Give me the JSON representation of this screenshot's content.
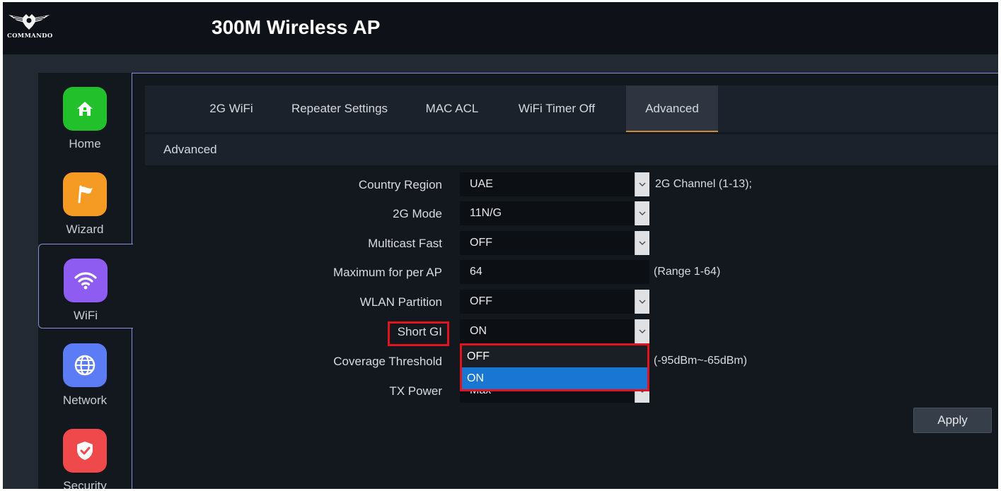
{
  "app": {
    "logo_text": "COMMANDO",
    "title": "300M Wireless AP"
  },
  "sidebar": {
    "items": [
      {
        "label": "Home",
        "icon": "home-icon",
        "color": "#22c02a"
      },
      {
        "label": "Wizard",
        "icon": "flag-icon",
        "color": "#f59a23"
      },
      {
        "label": "WiFi",
        "icon": "wifi-icon",
        "color": "#8e5cf0",
        "active": true
      },
      {
        "label": "Network",
        "icon": "globe-icon",
        "color": "#5b7cf5"
      },
      {
        "label": "Security",
        "icon": "shield-icon",
        "color": "#f0494c"
      }
    ]
  },
  "tabs": [
    {
      "label": "2G WiFi"
    },
    {
      "label": "Repeater Settings"
    },
    {
      "label": "MAC ACL"
    },
    {
      "label": "WiFi Timer Off"
    },
    {
      "label": "Advanced",
      "active": true
    }
  ],
  "section": {
    "title": "Advanced"
  },
  "form": {
    "country_region": {
      "label": "Country Region",
      "value": "UAE",
      "hint": "2G Channel (1-13);"
    },
    "mode_2g": {
      "label": "2G Mode",
      "value": "11N/G"
    },
    "multicast_fast": {
      "label": "Multicast Fast",
      "value": "OFF"
    },
    "max_per_ap": {
      "label": "Maximum for per AP",
      "value": "64",
      "hint": "(Range 1-64)"
    },
    "wlan_partition": {
      "label": "WLAN Partition",
      "value": "OFF"
    },
    "short_gi": {
      "label": "Short GI",
      "value": "ON",
      "options": [
        "OFF",
        "ON"
      ],
      "highlighted_option": "ON"
    },
    "coverage_threshold": {
      "label": "Coverage Threshold",
      "hint": "(-95dBm~-65dBm)"
    },
    "tx_power": {
      "label": "TX Power",
      "value": "Max"
    }
  },
  "buttons": {
    "apply": "Apply"
  },
  "colors": {
    "accent": "#c98d3a",
    "highlight": "#e0141c",
    "selected_option": "#1976d2",
    "active_border": "#8a8fd8"
  }
}
